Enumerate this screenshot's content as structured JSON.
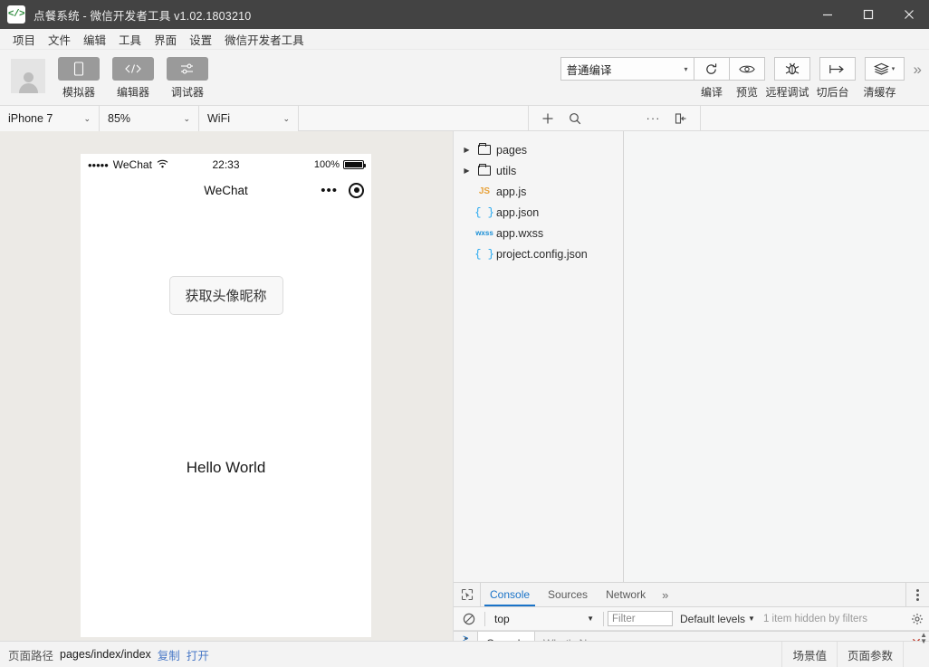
{
  "window": {
    "title": "点餐系统 - 微信开发者工具 v1.02.1803210",
    "logo_glyph": "</>",
    "controls": {
      "minimize": "minimize-icon",
      "maximize": "maximize-icon",
      "close": "close-icon"
    }
  },
  "menu": {
    "items": [
      {
        "label": "项目"
      },
      {
        "label": "文件"
      },
      {
        "label": "编辑"
      },
      {
        "label": "工具"
      },
      {
        "label": "界面"
      },
      {
        "label": "设置"
      },
      {
        "label": "微信开发者工具"
      }
    ]
  },
  "toolbar": {
    "left_buttons": [
      {
        "label": "模拟器",
        "icon": "phone-icon"
      },
      {
        "label": "编辑器",
        "icon": "code-icon"
      },
      {
        "label": "调试器",
        "icon": "sliders-icon"
      }
    ],
    "compile_mode": {
      "value": "普通编译",
      "caret": "▾"
    },
    "right_buttons": [
      {
        "label": "编译",
        "icon": "refresh-icon"
      },
      {
        "label": "预览",
        "icon": "eye-icon"
      },
      {
        "label": "远程调试",
        "icon": "bug-icon"
      },
      {
        "label": "切后台",
        "icon": "background-icon"
      },
      {
        "label": "清缓存",
        "icon": "layers-icon",
        "caret": "▾"
      }
    ],
    "overflow": "»"
  },
  "device_bar": {
    "selects": [
      {
        "value": "iPhone 7",
        "caret": "⌄"
      },
      {
        "value": "85%",
        "caret": "⌄"
      },
      {
        "value": "WiFi",
        "caret": "⌄"
      }
    ]
  },
  "file_toolbar": {
    "icons": [
      {
        "name": "add-file-icon",
        "glyph": "+"
      },
      {
        "name": "search-icon",
        "glyph": "search"
      },
      {
        "name": "more-icon",
        "glyph": "···"
      },
      {
        "name": "collapse-panel-icon",
        "glyph": "collapse"
      }
    ]
  },
  "file_tree": {
    "items": [
      {
        "label": "pages",
        "type": "folder",
        "expanded": false,
        "arrow": "▶"
      },
      {
        "label": "utils",
        "type": "folder",
        "expanded": false,
        "arrow": "▶"
      },
      {
        "label": "app.js",
        "type": "js",
        "icon_text": "JS"
      },
      {
        "label": "app.json",
        "type": "json",
        "icon_text": "{ }"
      },
      {
        "label": "app.wxss",
        "type": "wxss",
        "icon_text": "wxss"
      },
      {
        "label": "project.config.json",
        "type": "json",
        "icon_text": "{ }"
      }
    ]
  },
  "simulator": {
    "status_bar": {
      "signal_dots": "•••••",
      "carrier": "WeChat",
      "wifi": "wifi-icon",
      "time": "22:33",
      "battery_pct": "100%"
    },
    "nav": {
      "title": "WeChat",
      "menu_dots": "•••",
      "target": "target-icon"
    },
    "content": {
      "button_label": "获取头像昵称",
      "text": "Hello World"
    }
  },
  "devtools": {
    "inspect_icon": "inspect-element-icon",
    "tabs": [
      {
        "label": "Console",
        "active": true
      },
      {
        "label": "Sources",
        "active": false
      },
      {
        "label": "Network",
        "active": false
      }
    ],
    "tabs_overflow": "»",
    "kebab": "more-options-icon",
    "filter_bar": {
      "clear_icon": "clear-console-icon",
      "context": "top",
      "context_caret": "▼",
      "filter_placeholder": "Filter",
      "levels": "Default levels",
      "levels_caret": "▼",
      "hidden_note": "1 item hidden by filters",
      "settings_icon": "gear-icon"
    },
    "console_prompt": ">",
    "drawer": {
      "kebab": "drawer-more-icon",
      "tabs": [
        {
          "label": "Console",
          "active": true
        },
        {
          "label": "What's New",
          "active": false
        }
      ],
      "close": "✕"
    }
  },
  "statusbar": {
    "path_label": "页面路径",
    "path_value": "pages/index/index",
    "copy_link": "复制",
    "open_link": "打开",
    "scene_value": "场景值",
    "page_params": "页面参数"
  },
  "colors": {
    "titlebar_bg": "#434343",
    "accent_blue": "#1a73c8",
    "link_blue": "#4a79c7",
    "sim_bg": "#eceae6",
    "logo_green": "#2e8b3d"
  }
}
